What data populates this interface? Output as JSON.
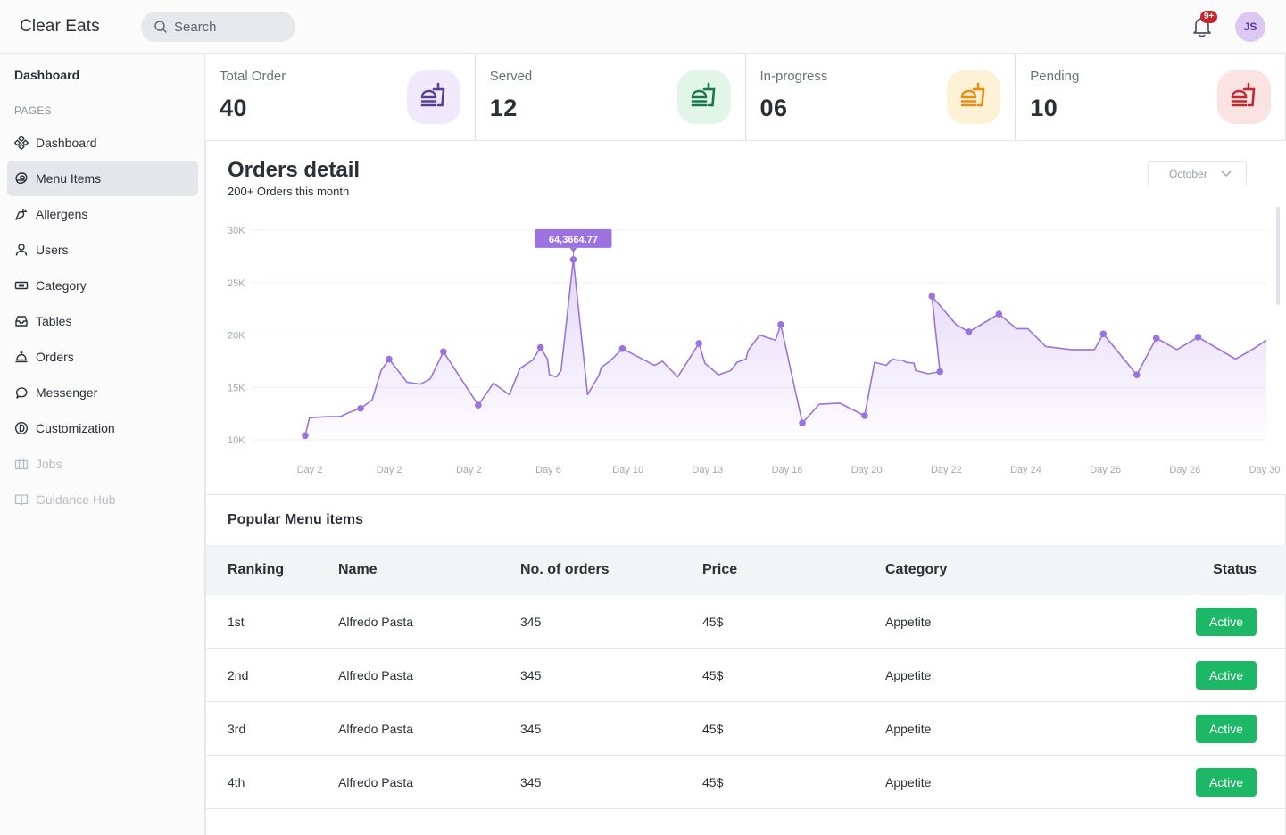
{
  "header": {
    "brand": "Clear Eats",
    "search_placeholder": "Search",
    "notification_count": "9+",
    "avatar_initials": "JS"
  },
  "sidebar": {
    "title": "Dashboard",
    "section": "PAGES",
    "items": [
      {
        "label": "Dashboard",
        "icon": "grid-diamond-icon",
        "active": false,
        "disabled": false
      },
      {
        "label": "Menu Items",
        "icon": "steak-icon",
        "active": true,
        "disabled": false
      },
      {
        "label": "Allergens",
        "icon": "carrot-icon",
        "active": false,
        "disabled": false
      },
      {
        "label": "Users",
        "icon": "user-icon",
        "active": false,
        "disabled": false
      },
      {
        "label": "Category",
        "icon": "ticket-icon",
        "active": false,
        "disabled": false
      },
      {
        "label": "Tables",
        "icon": "inbox-icon",
        "active": false,
        "disabled": false
      },
      {
        "label": "Orders",
        "icon": "service-bell-icon",
        "active": false,
        "disabled": false
      },
      {
        "label": "Messenger",
        "icon": "chat-icon",
        "active": false,
        "disabled": false
      },
      {
        "label": "Customization",
        "icon": "palette-icon",
        "active": false,
        "disabled": false
      },
      {
        "label": "Jobs",
        "icon": "briefcase-icon",
        "active": false,
        "disabled": true
      },
      {
        "label": "Guidance Hub",
        "icon": "book-icon",
        "active": false,
        "disabled": true
      }
    ]
  },
  "stats": [
    {
      "label": "Total Order",
      "value": "40",
      "icon": "fast-food-icon",
      "color": "#5a3e96",
      "bg": "#efe9fb"
    },
    {
      "label": "Served",
      "value": "12",
      "icon": "fast-food-icon",
      "color": "#16794a",
      "bg": "#e1f5e9"
    },
    {
      "label": "In-progress",
      "value": "06",
      "icon": "fast-food-icon",
      "color": "#e8900e",
      "bg": "#fdf1d6"
    },
    {
      "label": "Pending",
      "value": "10",
      "icon": "fast-food-icon",
      "color": "#c0282d",
      "bg": "#fbe3e3"
    }
  ],
  "orders_detail": {
    "title": "Orders detail",
    "subtitle": "200+ Orders this month",
    "month_selected": "October"
  },
  "chart_data": {
    "type": "area",
    "title": "Orders detail",
    "xlabel": "",
    "ylabel": "",
    "ylim": [
      10000,
      30000
    ],
    "xlim": [
      1,
      30
    ],
    "yticks": [
      10000,
      15000,
      20000,
      25000,
      30000
    ],
    "ytick_labels": [
      "10K",
      "15K",
      "20K",
      "25K",
      "30K"
    ],
    "xtick_labels": [
      "Day 2",
      "Day 2",
      "Day 2",
      "Day 6",
      "Day 10",
      "Day 13",
      "Day 18",
      "Day 20",
      "Day 22",
      "Day 24",
      "Day 26",
      "Day 28",
      "Day 30"
    ],
    "grid": true,
    "color": "#9b72e0",
    "tooltip": {
      "label": "64,3664.77",
      "point_index": 25
    },
    "series": [
      {
        "name": "Orders",
        "points": [
          {
            "x": 1.0,
            "y": 10400,
            "marker": true
          },
          {
            "x": 1.13,
            "y": 12100
          },
          {
            "x": 1.65,
            "y": 12200
          },
          {
            "x": 2.05,
            "y": 12200
          },
          {
            "x": 2.32,
            "y": 12600
          },
          {
            "x": 2.67,
            "y": 13000,
            "marker": true
          },
          {
            "x": 3.02,
            "y": 13800
          },
          {
            "x": 3.29,
            "y": 16600
          },
          {
            "x": 3.53,
            "y": 17700,
            "marker": true
          },
          {
            "x": 4.07,
            "y": 15500
          },
          {
            "x": 4.47,
            "y": 15300
          },
          {
            "x": 4.77,
            "y": 15800
          },
          {
            "x": 5.17,
            "y": 18400,
            "marker": true
          },
          {
            "x": 6.22,
            "y": 13300,
            "marker": true
          },
          {
            "x": 6.68,
            "y": 15400
          },
          {
            "x": 7.16,
            "y": 14300
          },
          {
            "x": 7.48,
            "y": 16800
          },
          {
            "x": 7.86,
            "y": 17600
          },
          {
            "x": 8.1,
            "y": 18800,
            "marker": true
          },
          {
            "x": 8.31,
            "y": 17700
          },
          {
            "x": 8.37,
            "y": 16200
          },
          {
            "x": 8.58,
            "y": 16000
          },
          {
            "x": 8.72,
            "y": 16600
          },
          {
            "x": 9.09,
            "y": 27200,
            "marker": true
          },
          {
            "x": 9.52,
            "y": 14300
          },
          {
            "x": 9.87,
            "y": 16200
          },
          {
            "x": 9.93,
            "y": 16900
          },
          {
            "x": 10.19,
            "y": 17500
          },
          {
            "x": 10.57,
            "y": 18700,
            "marker": true
          },
          {
            "x": 11.54,
            "y": 17100
          },
          {
            "x": 11.78,
            "y": 17500
          },
          {
            "x": 12.24,
            "y": 16000
          },
          {
            "x": 12.88,
            "y": 19200,
            "marker": true
          },
          {
            "x": 13.06,
            "y": 17300
          },
          {
            "x": 13.47,
            "y": 16200
          },
          {
            "x": 13.84,
            "y": 16600
          },
          {
            "x": 14.03,
            "y": 17400
          },
          {
            "x": 14.3,
            "y": 17700
          },
          {
            "x": 14.36,
            "y": 18500
          },
          {
            "x": 14.71,
            "y": 20000
          },
          {
            "x": 15.19,
            "y": 19500
          },
          {
            "x": 15.35,
            "y": 21000,
            "marker": true
          },
          {
            "x": 16.0,
            "y": 11600,
            "marker": true
          },
          {
            "x": 16.51,
            "y": 13400
          },
          {
            "x": 17.13,
            "y": 13500
          },
          {
            "x": 17.88,
            "y": 12300,
            "marker": true
          },
          {
            "x": 18.18,
            "y": 17400
          },
          {
            "x": 18.53,
            "y": 17100
          },
          {
            "x": 18.72,
            "y": 17700
          },
          {
            "x": 18.86,
            "y": 17600
          },
          {
            "x": 19.02,
            "y": 17600
          },
          {
            "x": 19.13,
            "y": 17400
          },
          {
            "x": 19.37,
            "y": 17300
          },
          {
            "x": 19.42,
            "y": 16600
          },
          {
            "x": 19.8,
            "y": 16300
          },
          {
            "x": 20.15,
            "y": 16500,
            "marker": true
          },
          {
            "x": 19.91,
            "y": 23700,
            "marker": true
          },
          {
            "x": 20.64,
            "y": 21000
          },
          {
            "x": 21.02,
            "y": 20300,
            "marker": true
          },
          {
            "x": 21.93,
            "y": 22000,
            "marker": true
          },
          {
            "x": 22.46,
            "y": 20600
          },
          {
            "x": 22.8,
            "y": 20600
          },
          {
            "x": 23.34,
            "y": 18900
          },
          {
            "x": 24.11,
            "y": 18600
          },
          {
            "x": 24.81,
            "y": 18600
          },
          {
            "x": 25.08,
            "y": 20100,
            "marker": true
          },
          {
            "x": 26.09,
            "y": 16200,
            "marker": true
          },
          {
            "x": 26.68,
            "y": 19700,
            "marker": true
          },
          {
            "x": 27.3,
            "y": 18600
          },
          {
            "x": 27.94,
            "y": 19800,
            "marker": true
          },
          {
            "x": 29.07,
            "y": 17700
          },
          {
            "x": 29.57,
            "y": 18600
          },
          {
            "x": 30.0,
            "y": 19500
          }
        ]
      }
    ]
  },
  "popular_menu": {
    "title": "Popular Menu items",
    "columns": [
      "Ranking",
      "Name",
      "No. of orders",
      "Price",
      "Category",
      "Status"
    ],
    "rows": [
      {
        "ranking": "1st",
        "name": "Alfredo Pasta",
        "orders": "345",
        "price": "45$",
        "category": "Appetite",
        "status": "Active"
      },
      {
        "ranking": "2nd",
        "name": "Alfredo Pasta",
        "orders": "345",
        "price": "45$",
        "category": "Appetite",
        "status": "Active"
      },
      {
        "ranking": "3rd",
        "name": "Alfredo Pasta",
        "orders": "345",
        "price": "45$",
        "category": "Appetite",
        "status": "Active"
      },
      {
        "ranking": "4th",
        "name": "Alfredo Pasta",
        "orders": "345",
        "price": "45$",
        "category": "Appetite",
        "status": "Active"
      }
    ]
  }
}
